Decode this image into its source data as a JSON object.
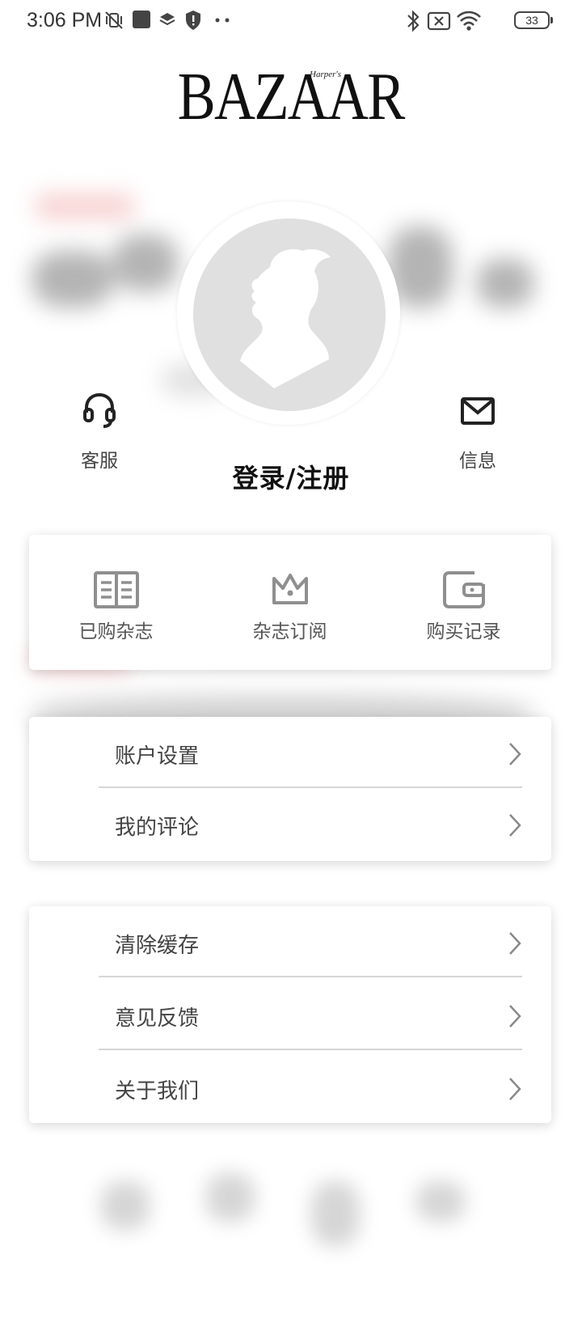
{
  "status_bar": {
    "time": "3:06 PM",
    "battery": "33",
    "left_icons": [
      "mute-vibrate-icon",
      "app-square-icon",
      "layers-icon",
      "shield-icon",
      "more-dots-icon"
    ],
    "right_icons": [
      "bluetooth-icon",
      "no-sim-icon",
      "wifi-icon",
      "battery-icon"
    ]
  },
  "logo": {
    "main": "BAZAAR",
    "small": "Harper's"
  },
  "profile": {
    "customer_service_label": "客服",
    "login_label": "登录/注册",
    "messages_label": "信息"
  },
  "quick_actions": [
    {
      "label": "已购杂志",
      "icon": "open-book-icon"
    },
    {
      "label": "杂志订阅",
      "icon": "crown-icon"
    },
    {
      "label": "购买记录",
      "icon": "wallet-icon"
    }
  ],
  "account_menu": [
    {
      "label": "账户设置"
    },
    {
      "label": "我的评论"
    }
  ],
  "app_menu": [
    {
      "label": "清除缓存"
    },
    {
      "label": "意见反馈"
    },
    {
      "label": "关于我们"
    }
  ],
  "colors": {
    "icon_gray": "#8f8f8f",
    "card_shadow": "#cccccc",
    "divider": "#d6d6d6"
  }
}
